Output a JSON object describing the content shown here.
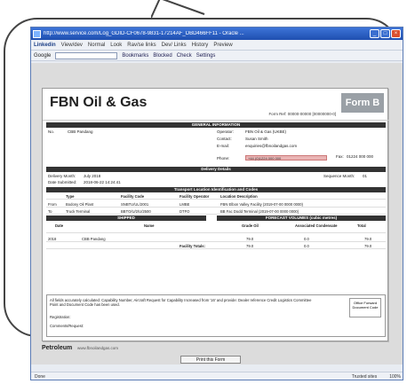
{
  "browser": {
    "title": "http://www.service.com/Log_GDID-CF0678-9831-17214AF_DBD466FF11 - Oracle ...",
    "menu": [
      "Linkedin",
      "View/dev",
      "Normal",
      "Look",
      "Rav/se links",
      "Dev/ Links",
      "History",
      "Preview"
    ],
    "toolbar_label": "Google",
    "toolbar_items": [
      "Bookmarks",
      "Blocked",
      "Check",
      "Settings"
    ],
    "status_left": "Done",
    "status_zone": "Trusted sites",
    "status_zoom": "100%"
  },
  "doc": {
    "company": "FBN Oil & Gas",
    "form_label": "Form B",
    "ref": "Form Ref: 00000-00000 [00000000-0]",
    "sections": {
      "general": "GENERAL INFORMATION",
      "delivery": "Delivery Details",
      "locations": "Transport Location Identification and Codes",
      "shipped": "SHIPPED",
      "forecast": "FORECAST VOLUMES (cubic metres)"
    },
    "general": {
      "no_label": "No.",
      "no_value": "CBB Pandang",
      "operator_label": "Operator:",
      "operator_value": "FBN Oil & Gas (UKBE)",
      "contact_label": "Contact:",
      "contact_value": "Susan Smith",
      "email_label": "E-mail:",
      "email_value": "enquiries@fbnoilandgas.com",
      "phone_label": "Phone:",
      "phone_value": "+44 (0)1224 000 000",
      "fax_label": "Fax:",
      "fax_value": "01224 000 000"
    },
    "delivery": {
      "month_label": "Delivery Month:",
      "month_value": "July 2018",
      "date_label": "Date Submitted:",
      "date_value": "2018-06-22 14:24:41",
      "sequence_label": "Sequence Month:",
      "sequence_value": "01"
    },
    "loc_headers": [
      "Type",
      "Facility Code",
      "Facility Operator",
      "Location Description"
    ],
    "loc_rows": [
      [
        "From",
        "Bodony Oil Plant",
        "SNBTU/UL/2001",
        "LMBE",
        "FBN Elbon Valley Facility (2019-07-00 0000 0000)"
      ],
      [
        "To",
        "Truck Terminal",
        "BBTO/U/2/U/2500",
        "DTFO",
        "BB Fac Dodd Terminal (2019-07-00 0000 0000)"
      ]
    ],
    "ship_headers": [
      "Date",
      "Name",
      "Grade Oil",
      "Associated Condensate",
      "Total"
    ],
    "ship_rows": [
      [
        "2018",
        "CBB Pandang",
        "79.0",
        "0.0",
        "79.0"
      ]
    ],
    "totals_label": "Facility Totals:",
    "totals": [
      "79.0",
      "0.0",
      "79.0"
    ],
    "note_text": "All fields accurately calculated: Capability Number, Aircraft Request for Capability Increased from '16' and provide: Dealer reference Credit Logistics Committee Point and Document Code has been used.",
    "note_box": "Office Forward Document Code",
    "note_line1": "Registration:",
    "note_line2": "Comments/Request:",
    "footer_brand": "Petroleum",
    "footer_url": "www.fbnoilandgas.com",
    "print_label": "Print this Form"
  }
}
